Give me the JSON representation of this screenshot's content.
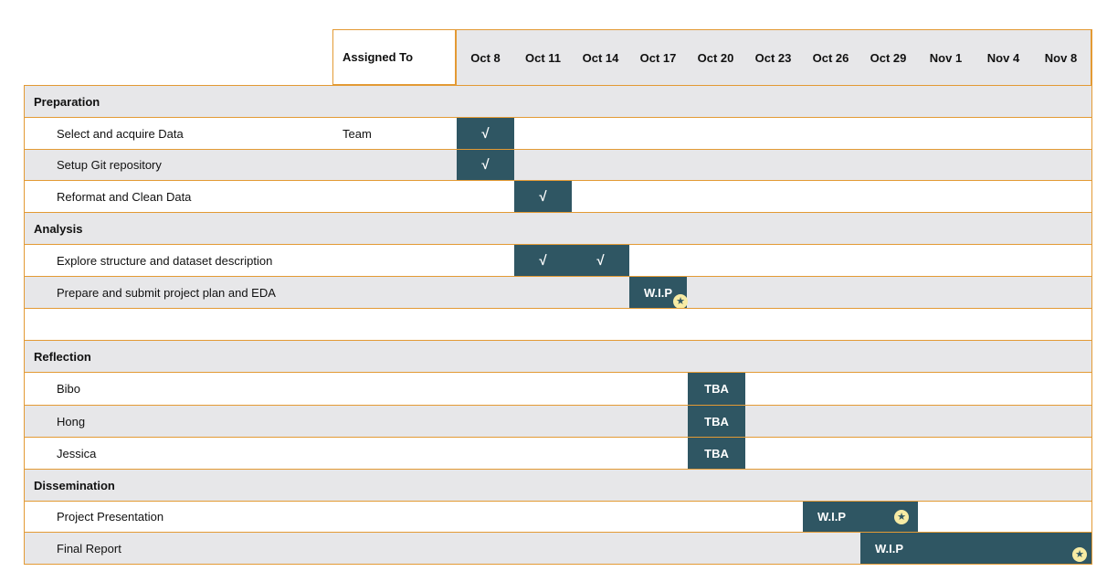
{
  "header": {
    "assigned_to": "Assigned To",
    "dates": [
      "Oct 8",
      "Oct 11",
      "Oct 14",
      "Oct 17",
      "Oct 20",
      "Oct 23",
      "Oct 26",
      "Oct 29",
      "Nov 1",
      "Nov 4",
      "Nov 8"
    ]
  },
  "sections": {
    "preparation": "Preparation",
    "analysis": "Analysis",
    "reflection": "Reflection",
    "dissemination": "Dissemination"
  },
  "tasks": {
    "select_data": {
      "label": "Select and acquire Data",
      "assigned": "Team",
      "mark": "√"
    },
    "setup_git": {
      "label": "Setup Git repository",
      "mark": "√"
    },
    "reformat": {
      "label": "Reformat and Clean Data",
      "mark": "√"
    },
    "explore": {
      "label": "Explore structure and dataset description",
      "marks": [
        "√",
        "√"
      ]
    },
    "prepare_plan": {
      "label": "Prepare and submit project plan and EDA",
      "mark": "W.I.P"
    },
    "bibo": {
      "label": "Bibo",
      "mark": "TBA"
    },
    "hong": {
      "label": "Hong",
      "mark": "TBA"
    },
    "jessica": {
      "label": "Jessica",
      "mark": "TBA"
    },
    "presentation": {
      "label": "Project Presentation",
      "mark": "W.I.P"
    },
    "final_report": {
      "label": "Final Report",
      "mark": "W.I.P"
    }
  },
  "icons": {
    "milestone": "star-icon"
  },
  "colors": {
    "bar": "#2f5663",
    "border": "#e39a34",
    "band": "#e7e7e9",
    "star": "#f7eba4"
  }
}
